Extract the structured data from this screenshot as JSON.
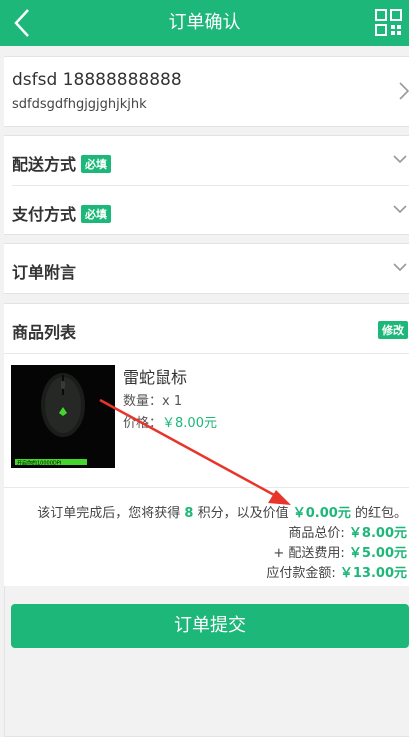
{
  "header": {
    "title": "订单确认",
    "back_icon": "chevron-left-icon",
    "menu_icon": "grid-icon"
  },
  "address": {
    "name_phone": "dsfsd 18888888888",
    "detail": "sdfdsgdfhgjgjghjkjhk"
  },
  "shipping": {
    "label": "配送方式",
    "badge": "必填"
  },
  "payment": {
    "label": "支付方式",
    "badge": "必填"
  },
  "order_note": {
    "label": "订单附言"
  },
  "goods": {
    "title": "商品列表",
    "edit_label": "修改",
    "items": [
      {
        "name": "雷蛇鼠标",
        "qty_label": "数量：",
        "qty": "x 1",
        "price_label": "价格：",
        "price": "￥8.00元",
        "image_text": "开启你的10000DPI"
      }
    ]
  },
  "reward": {
    "prefix": "该订单完成后，您将获得",
    "points": "8",
    "middle": "积分，以及价值",
    "bonus": "￥0.00元",
    "suffix": "的红包。"
  },
  "totals": {
    "goods_total_label": "商品总价:",
    "goods_total": "￥8.00元",
    "shipping_label": "+ 配送费用:",
    "shipping": "￥5.00元",
    "payable_label": "应付款金额:",
    "payable": "￥13.00元"
  },
  "submit_label": "订单提交",
  "colors": {
    "accent": "#1cb779",
    "annotation_arrow": "#e8352b"
  }
}
